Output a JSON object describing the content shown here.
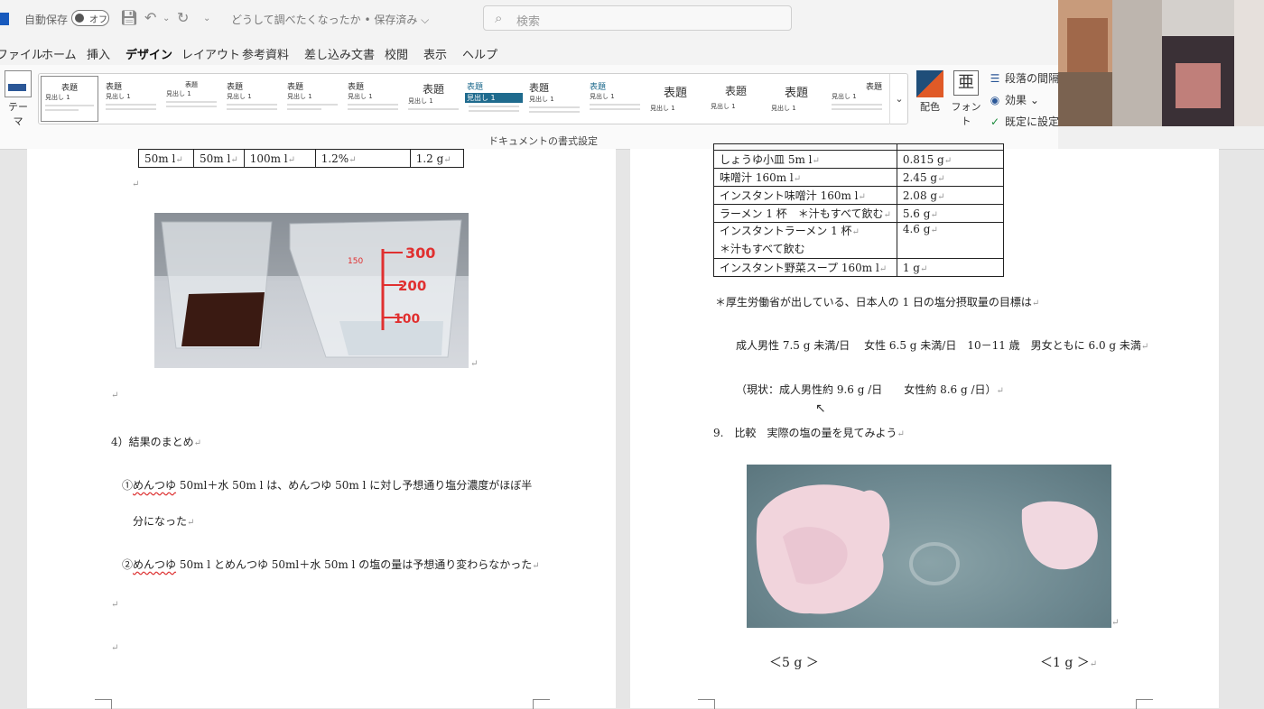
{
  "titlebar": {
    "autosave_label": "自動保存",
    "autosave_state": "オフ",
    "doc_title": "どうして調べたくなったか • 保存済み ⌵",
    "search_placeholder": "検索"
  },
  "tabs": [
    {
      "label": "ファイル"
    },
    {
      "label": "ホーム"
    },
    {
      "label": "挿入"
    },
    {
      "label": "デザイン"
    },
    {
      "label": "レイアウト"
    },
    {
      "label": "参考資料"
    },
    {
      "label": "差し込み文書"
    },
    {
      "label": "校閲"
    },
    {
      "label": "表示"
    },
    {
      "label": "ヘルプ"
    }
  ],
  "ribbon": {
    "theme_label": "テーマ",
    "style_title": "表題",
    "style_heading": "見出し 1",
    "color_label": "配色",
    "font_label": "フォント",
    "paragraph_spacing": "段落の間隔",
    "effects": "効果 ⌄",
    "set_default": "既定に設定",
    "group_label": "ドキュメントの書式設定"
  },
  "left_page": {
    "table_row": [
      "50m l",
      "50m l",
      "100m l",
      "1.2%",
      "1.2 g"
    ],
    "section_title": "4）結果のまとめ",
    "summary_1a_pre": "①",
    "summary_1a_sq": "めんつゆ",
    "summary_1a_post": " 50ml＋水 50m l は、めんつゆ 50m l に対し予想通り塩分濃度がほぼ半",
    "summary_1b": "分になった",
    "summary_2_pre": "②",
    "summary_2_sq": "めんつゆ",
    "summary_2_post": " 50m l とめんつゆ 50ml＋水 50m l の塩の量は予想通り変わらなかった",
    "cup_marks": [
      "300",
      "200",
      "100",
      "150"
    ]
  },
  "right_page": {
    "salt_table": [
      {
        "item": "しょうゆ小皿 5m l",
        "value": "0.815 g"
      },
      {
        "item": "味噌汁 160m l",
        "value": "2.45 g"
      },
      {
        "item": "インスタント味噌汁 160m l",
        "value": "2.08 g"
      },
      {
        "item": "ラーメン 1 杯　＊汁もすべて飲む",
        "value": "5.6 g"
      },
      {
        "item": "インスタントラーメン 1 杯",
        "item2": "＊汁もすべて飲む",
        "value": "4.6 g"
      },
      {
        "item": "インスタント野菜スープ 160m l",
        "value": "1 g"
      }
    ],
    "note": "＊厚生労働省が出している、日本人の 1 日の塩分摂取量の目標は",
    "target": "成人男性 7.5 g 未満/日　 女性 6.5 g 未満/日　10－11 歳　男女ともに 6.0 g 未満",
    "current": "（現状：成人男性約 9.6 g /日　　女性約 8.6 g /日）",
    "section9": "9.　比較　実際の塩の量を見てみよう",
    "caption_left": "＜5 g ＞",
    "caption_right": "＜1 g ＞"
  },
  "colors": {
    "accent": "#185abd",
    "page": "#ffffff",
    "workspace": "#e6e6e6"
  }
}
